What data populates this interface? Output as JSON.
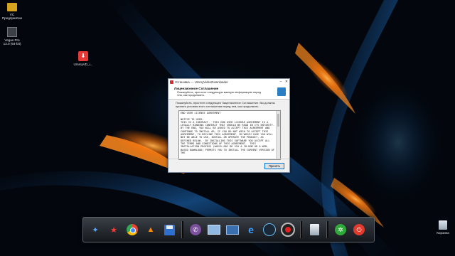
{
  "desktop": {
    "icons": [
      {
        "name": "vegas-pro-icon",
        "label_line1": "Vegas Pro",
        "label_line2": "13.0 (64-bit)"
      },
      {
        "name": "youtube-downloader-icon",
        "label_line1": "UmmyVD_i...",
        "label_line2": ""
      },
      {
        "name": "recycle-bin-icon",
        "label_line1": "Корзина",
        "label_line2": ""
      }
    ],
    "top_left_fragment": "VC Предприятие"
  },
  "installer": {
    "title": "Установка — UmmyVideoDownloader",
    "header_title": "Лицензионное Соглашение",
    "header_subtitle": "Пожалуйста, прочтите следующую важную информацию перед тем, как продолжить.",
    "instructions": "Пожалуйста, прочтите следующее Лицензионное Соглашение. Вы должны принять условия этого соглашения перед тем, как продолжить.",
    "license_text": "END USER LICENSE AGREEMENT\n\nNOTICE TO USER:\nTHIS IS A CONTRACT.  THIS END USER LICENSE AGREEMENT IS A LEGALLY BINDING CONTRACT THAT SHOULD BE READ IN ITS ENTIRETY. BY THE END, YOU WILL BE ASKED TO ACCEPT THIS AGREEMENT AND CONTINUE TO INSTALL OR, IF YOU DO NOT WISH TO ACCEPT THIS AGREEMENT, TO DECLINE THIS AGREEMENT. IN WHICH CASE YOU WILL NOT BE ABLE TO USE, INSTALL OR OPERATE THE PRODUCT, AS DEFINED BELOW.  BY INSTALLING THIS SOFTWARE YOU ACCEPT ALL THE TERMS AND CONDITIONS OF THIS AGREEMENT.  THIS INSTALLATION PROCESS (WHICH MAY BE VIA A CD-ROM OR A WEB-BASED DOWNLOAD) PERMITS YOU TO INSTALL THE CURRENT VERSION OF THE",
    "accept_label": "Принять"
  },
  "dock": {
    "items": [
      "star-app-icon",
      "pokerstars-icon",
      "chrome-icon",
      "vlc-icon",
      "save-disk-icon",
      "viber-icon",
      "photo-viewer-icon",
      "network-icon",
      "internet-explorer-icon",
      "steam-icon",
      "record-icon",
      "recycle-bin-icon",
      "power-settings-icon",
      "shutdown-icon"
    ]
  },
  "colors": {
    "accent": "#0078d7",
    "wallpaper_glow_orange": "#ff8a1e",
    "wallpaper_glow_blue": "#1f8fff"
  }
}
